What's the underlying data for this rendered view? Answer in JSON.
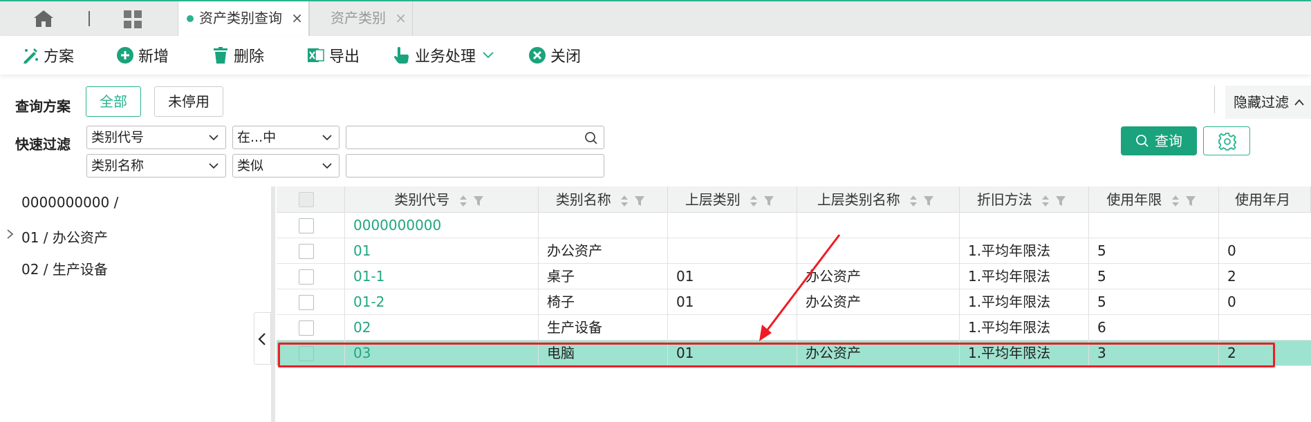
{
  "tabs": {
    "active_label": "资产类别查询",
    "inactive_label": "资产类别",
    "close_glyph": "×",
    "home_icon": "home-icon",
    "apps_icon": "grid-icon"
  },
  "toolbar": {
    "scheme": "方案",
    "add": "新增",
    "delete": "删除",
    "export": "导出",
    "business": "业务处理",
    "close": "关闭"
  },
  "filter": {
    "scheme_label": "查询方案",
    "all": "全部",
    "not_disabled": "未停用",
    "quick_label": "快速过滤",
    "field1": "类别代号",
    "op1": "在...中",
    "field2": "类别名称",
    "op2": "类似",
    "value1": "",
    "value2": "",
    "hide_filter": "隐藏过滤",
    "query": "查询"
  },
  "tree": {
    "items": [
      "0000000000 /",
      "01 / 办公资产",
      "02 / 生产设备"
    ]
  },
  "grid": {
    "columns": [
      "类别代号",
      "类别名称",
      "上层类别",
      "上层类别名称",
      "折旧方法",
      "使用年限",
      "使用年月"
    ],
    "rows": [
      {
        "code": "0000000000",
        "name": "",
        "parent": "",
        "parent_name": "",
        "method": "",
        "years": "",
        "months": ""
      },
      {
        "code": "01",
        "name": "办公资产",
        "parent": "",
        "parent_name": "",
        "method": "1.平均年限法",
        "years": "5",
        "months": "0"
      },
      {
        "code": "01-1",
        "name": "桌子",
        "parent": "01",
        "parent_name": "办公资产",
        "method": "1.平均年限法",
        "years": "5",
        "months": "2"
      },
      {
        "code": "01-2",
        "name": "椅子",
        "parent": "01",
        "parent_name": "办公资产",
        "method": "1.平均年限法",
        "years": "5",
        "months": "0"
      },
      {
        "code": "02",
        "name": "生产设备",
        "parent": "",
        "parent_name": "",
        "method": "1.平均年限法",
        "years": "6",
        "months": ""
      },
      {
        "code": "03",
        "name": "电脑",
        "parent": "01",
        "parent_name": "办公资产",
        "method": "1.平均年限法",
        "years": "3",
        "months": "2"
      }
    ],
    "selected_row": 5
  },
  "colors": {
    "accent": "#2ab38e",
    "selected_row": "#9ee3cf",
    "annotation": "#ee1c24"
  }
}
